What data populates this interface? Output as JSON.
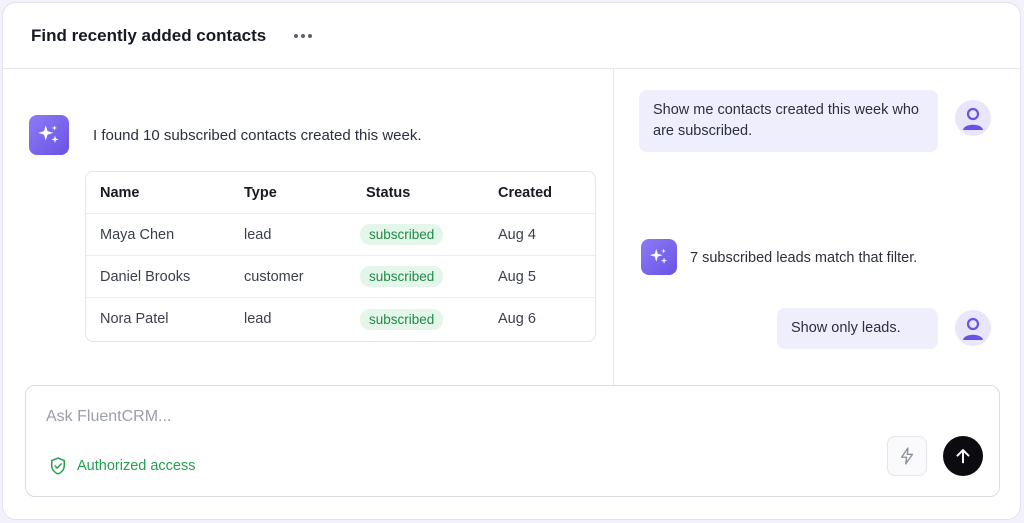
{
  "header": {
    "title": "Find recently added contacts",
    "more_icon": "more-horizontal-icon"
  },
  "left": {
    "assistant_message": "I found 10 subscribed contacts created this week.",
    "table": {
      "columns": [
        "Name",
        "Type",
        "Status",
        "Created"
      ],
      "rows": [
        [
          "Maya Chen",
          "lead",
          "subscribed",
          "Aug 4"
        ],
        [
          "Daniel Brooks",
          "customer",
          "subscribed",
          "Aug 5"
        ],
        [
          "Nora Patel",
          "lead",
          "subscribed",
          "Aug 6"
        ]
      ]
    }
  },
  "right": {
    "user_message_1": "Show me contacts created this week who are subscribed.",
    "assistant_message": "7 subscribed leads match that filter.",
    "user_message_2": "Show only leads."
  },
  "composer": {
    "placeholder": "Ask FluentCRM...",
    "auth_label": "Authorized access",
    "bolt_icon": "lightning-icon",
    "send_icon": "arrow-up-icon"
  },
  "colors": {
    "accent": "#7a67ef",
    "badge_bg": "#e4f6ea",
    "badge_text": "#1f8a45",
    "auth_green": "#22a04e"
  }
}
